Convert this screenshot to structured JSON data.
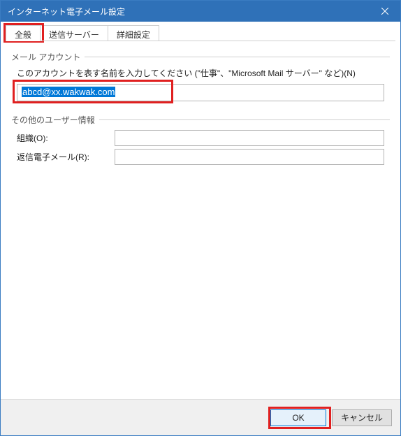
{
  "window": {
    "title": "インターネット電子メール設定"
  },
  "tabs": {
    "general": "全般",
    "outgoing": "送信サーバー",
    "advanced": "詳細設定"
  },
  "groups": {
    "mail_account": {
      "title": "メール アカウント",
      "help": "このアカウントを表す名前を入力してください (\"仕事\"、\"Microsoft Mail サーバー\" など)(N)",
      "account_name": "abcd@xx.wakwak.com"
    },
    "other_user": {
      "title": "その他のユーザー情報",
      "org_label": "組織(O):",
      "reply_label": "返信電子メール(R):",
      "org_value": "",
      "reply_value": ""
    }
  },
  "buttons": {
    "ok": "OK",
    "cancel": "キャンセル"
  }
}
